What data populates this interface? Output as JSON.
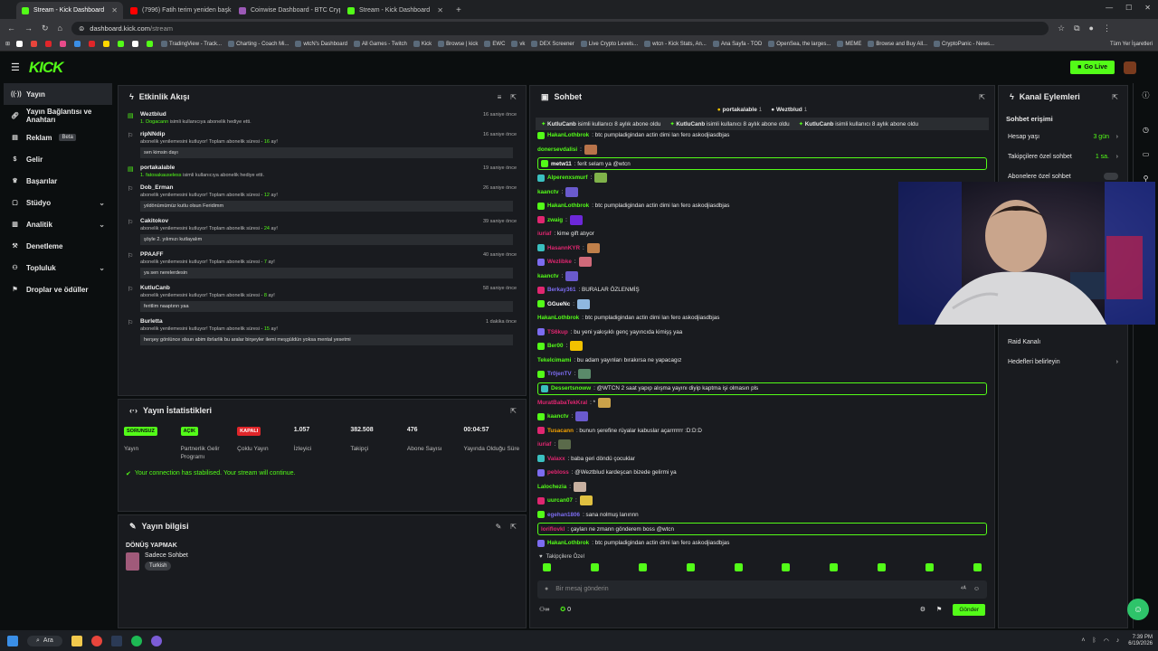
{
  "browser": {
    "tabs": [
      {
        "label": "Stream - Kick Dashboard",
        "color": "#53fc18",
        "active": true
      },
      {
        "label": "(7996) Fatih terim yeniden başk",
        "color": "#ff0000",
        "active": false
      },
      {
        "label": "Coinwise Dashboard - BTC Cryp",
        "color": "#9b59b6",
        "active": false
      },
      {
        "label": "Stream - Kick Dashboard",
        "color": "#53fc18",
        "active": false
      }
    ],
    "url_host": "dashboard.kick.com",
    "url_path": "/stream",
    "bookmarks": [
      "TradingView - Track...",
      "Charting - Coach Mi...",
      "wtcN's Dashboard",
      "All Games - Twitch",
      "Kick",
      "Browse | kick",
      "EWC",
      "vk",
      "DEX Screener",
      "Live Crypto Levels...",
      "wtcn - Kick Stats, An...",
      "Ana Sayfa - TOD",
      "OpenSea, the larges...",
      "MEME",
      "Browse and Buy All...",
      "CryptoPanic - News..."
    ],
    "bookmarks_right": "Tüm Yer İşaretleri"
  },
  "header": {
    "logo": "KICK",
    "go_live": "Go Live"
  },
  "sidebar": {
    "items": [
      {
        "label": "Yayın",
        "icon": "broadcast-icon"
      },
      {
        "label": "Yayın Bağlantısı ve Anahtarı",
        "icon": "link-icon"
      },
      {
        "label": "Reklam",
        "icon": "ad-icon",
        "badge": "Beta"
      },
      {
        "label": "Gelir",
        "icon": "money-icon"
      },
      {
        "label": "Başarılar",
        "icon": "trophy-icon"
      },
      {
        "label": "Stüdyo",
        "icon": "studio-icon"
      },
      {
        "label": "Analitik",
        "icon": "chart-icon"
      },
      {
        "label": "Denetleme",
        "icon": "moderation-icon"
      },
      {
        "label": "Topluluk",
        "icon": "community-icon"
      },
      {
        "label": "Droplar ve ödüller",
        "icon": "gift-icon"
      }
    ]
  },
  "activity": {
    "title": "Etkinlik Akışı",
    "items": [
      {
        "user": "Weztblud",
        "color": "#53fc18",
        "desc_hl": "1. Dogacann",
        "desc": " isimli kullanıcıya abonelik hediye etti.",
        "time": "16 saniye önce",
        "msg": ""
      },
      {
        "user": "ripNNdip",
        "color": "#ffffff",
        "desc": "abonelik yenilemesini kutluyor! Toplam abonelik süresi - ",
        "months": "16",
        "suffix": " ay!",
        "time": "16 saniye önce",
        "msg": "sen kimsin dayı"
      },
      {
        "user": "portakalable",
        "color": "#53fc18",
        "desc_hl": "1. fatosakauseless",
        "desc": " isimli kullanıcıya abonelik hediye etti.",
        "time": "19 saniye önce",
        "msg": ""
      },
      {
        "user": "Dob_Erman",
        "color": "#ffffff",
        "desc": "abonelik yenilemesini kutluyor! Toplam abonelik süresi - ",
        "months": "12",
        "suffix": " ay!",
        "time": "26 saniye önce",
        "msg": "yıldönümümüz kutlu olsun Feridimm"
      },
      {
        "user": "Cakitokov",
        "color": "#ffffff",
        "desc": "abonelik yenilemesini kutluyor! Toplam abonelik süresi - ",
        "months": "24",
        "suffix": " ay!",
        "time": "39 saniye önce",
        "msg": "şöyle 2. yılımızı kutlayalım"
      },
      {
        "user": "PPAAFF",
        "color": "#ffffff",
        "desc": "abonelik yenilemesini kutluyor! Toplam abonelik süresi - ",
        "months": "7",
        "suffix": " ay!",
        "time": "40 saniye önce",
        "msg": "ya sen nerelerdesin"
      },
      {
        "user": "KutluCanb",
        "color": "#ffffff",
        "desc": "abonelik yenilemesini kutluyor! Toplam abonelik süresi - ",
        "months": "8",
        "suffix": " ay!",
        "time": "58 saniye önce",
        "msg": "feritlim naaptınn yaa"
      },
      {
        "user": "Burletta",
        "color": "#ffffff",
        "desc": "abonelik yenilemesini kutluyor! Toplam abonelik süresi - ",
        "months": "15",
        "suffix": " ay!",
        "time": "1 dakika önce",
        "msg": "herşey gönlünce olsun abim ibrlarlik bu aralar birşeyler ilemi meşgüldün yoksa mental yesetmi"
      }
    ]
  },
  "stats": {
    "title": "Yayın İstatistikleri",
    "items": [
      {
        "value": "SORUNSUZ",
        "label": "Yayın",
        "pill": "#53fc18",
        "pill_text": "#0b0e0f"
      },
      {
        "value": "AÇIK",
        "label": "Partnerlik Gelir Programı",
        "pill": "#53fc18",
        "pill_text": "#0b0e0f"
      },
      {
        "value": "KAPALI",
        "label": "Çoklu Yayın",
        "pill": "#e0262a",
        "pill_text": "#ffffff"
      },
      {
        "value": "1.057",
        "label": "İzleyici"
      },
      {
        "value": "382.508",
        "label": "Takipçi"
      },
      {
        "value": "476",
        "label": "Abone Sayısı"
      },
      {
        "value": "00:04:57",
        "label": "Yayında Olduğu Süre"
      }
    ],
    "status": "Your connection has stabilised. Your stream will continue."
  },
  "info": {
    "title": "Yayın bilgisi",
    "stream_title": "DÖNÜŞ YAPMAK",
    "category": "Sadece Sohbet",
    "tag": "Turkish"
  },
  "chat": {
    "title": "Sohbet",
    "pinned": [
      {
        "user": "portakalable",
        "count": "1"
      },
      {
        "user": "Weztblud",
        "count": "1"
      }
    ],
    "sub_ticker": [
      {
        "user": "KutluCanb",
        "text": " isimli kullanıcı 8 aylık abone oldu"
      },
      {
        "user": "KutluCanb",
        "text": " isimli kullanıcı 8 aylık abone oldu"
      },
      {
        "user": "KutluCanb",
        "text": " isimli kullanıcı 8 aylık abone oldu"
      }
    ],
    "messages": [
      {
        "user": "HakanLothbrok",
        "color": "#53fc18",
        "text": ": btc pumpladigindan actin dimi lan fero askodjiasdbjas"
      },
      {
        "user": "donersevdalisi",
        "color": "#53fc18",
        "text": ":",
        "emote": "#b8734a"
      },
      {
        "user": "metw11",
        "color": "#ffffff",
        "text": ": ferit selam ya @wtcn",
        "highlight": true
      },
      {
        "user": "Alperenxsmurf",
        "color": "#53fc18",
        "text": ":",
        "emote": "#7fb24a"
      },
      {
        "user": "kaanctv",
        "color": "#53fc18",
        "text": ":",
        "emote": "#6a5acd"
      },
      {
        "user": "HakanLothbrok",
        "color": "#53fc18",
        "text": ": btc pumpladigindan actin dimi lan fero askodjiasdbjas"
      },
      {
        "user": "zwaig",
        "color": "#53fc18",
        "text": ":",
        "emote": "#6d28d9"
      },
      {
        "user": "iuriaf",
        "color": "#e02670",
        "text": ": kime gift atıyor"
      },
      {
        "user": "HasannKYR",
        "color": "#e02670",
        "text": ":",
        "emote": "#c0804a"
      },
      {
        "user": "Wezlibke",
        "color": "#e02670",
        "text": ":",
        "emote": "#d06a7a"
      },
      {
        "user": "kaanctv",
        "color": "#53fc18",
        "text": ":",
        "emote": "#6a5acd"
      },
      {
        "user": "Berkay361",
        "color": "#7c6cf0",
        "text": ": BURALAR ÖZLENMİŞ"
      },
      {
        "user": "GGueNc",
        "color": "#ffffff",
        "text": ":",
        "emote": "#8fb8e0"
      },
      {
        "user": "HakanLothbrok",
        "color": "#53fc18",
        "text": ": btc pumpladigindan actin dimi lan fero askodjiasdbjas"
      },
      {
        "user": "TS6kup",
        "color": "#e02670",
        "text": ": bu yeni yakışıklı genç yayıncıda kimişş yaa"
      },
      {
        "user": "Ber00",
        "color": "#53fc18",
        "text": ":",
        "emote": "#f2c200"
      },
      {
        "user": "Tekelcimami",
        "color": "#53fc18",
        "text": ": bu adam yayınları bırakırsa ne yapacagız"
      },
      {
        "user": "Tr0jenTV",
        "color": "#7c6cf0",
        "text": ":",
        "emote": "#5a8a6a"
      },
      {
        "user": "Dessertsnoww",
        "color": "#53fc18",
        "text": ": @WTCN 2 saat yapıp alışma yayını diyip kaptma işi olmasın pls",
        "highlight": true
      },
      {
        "user": "MuratBabaTekKral",
        "color": "#e02670",
        "text": ": *",
        "emote": "#caa24a"
      },
      {
        "user": "kaanctv",
        "color": "#53fc18",
        "text": ":",
        "emote": "#6a5acd"
      },
      {
        "user": "Tusacann",
        "color": "#f2a000",
        "text": ": bunun şerefine rüyalar kabuslar açarrrrrrr :D:D:D"
      },
      {
        "user": "iuriaf",
        "color": "#e02670",
        "text": ":",
        "emote": "#5a6a4a"
      },
      {
        "user": "Valaxx",
        "color": "#e02670",
        "text": ": baba geri döndü çocuklar"
      },
      {
        "user": "pebloss",
        "color": "#e02670",
        "text": ": @Weztblud kardeşcan bizede gelirmi ya"
      },
      {
        "user": "Lalochezia",
        "color": "#53fc18",
        "text": ":",
        "emote": "#c8b0a0"
      },
      {
        "user": "uurcan07",
        "color": "#53fc18",
        "text": ":",
        "emote": "#e0c040"
      },
      {
        "user": "egehan1806",
        "color": "#7c6cf0",
        "text": ": sana nolmuş lanınnn"
      },
      {
        "user": "loriflovkl",
        "color": "#e02670",
        "text": ": çayları ne zmann gönderem boss @wtcn",
        "highlight": true
      },
      {
        "user": "HakanLothbrok",
        "color": "#53fc18",
        "text": ": btc pumpladigindan actin dimi lan fero askodjiasdbjas"
      }
    ],
    "mode": "Takipçilere Özel",
    "input_placeholder": "Bir mesaj gönderin",
    "send": "Gönder",
    "points": "0"
  },
  "channel": {
    "title": "Kanal Eylemleri",
    "section": "Sohbet erişimi",
    "rows": [
      {
        "label": "Hesap yaşı",
        "value": "3 gün"
      },
      {
        "label": "Takipçilere özel sohbet",
        "value": "1 sa."
      },
      {
        "label": "Abonelere özel sohbet",
        "value": ""
      }
    ],
    "lower_rows": [
      {
        "label": "Raid Kanalı"
      },
      {
        "label": "Hedefleri belirleyin"
      }
    ]
  },
  "taskbar": {
    "search": "Ara",
    "time": "7:39 PM",
    "date": "6/19/2026"
  }
}
